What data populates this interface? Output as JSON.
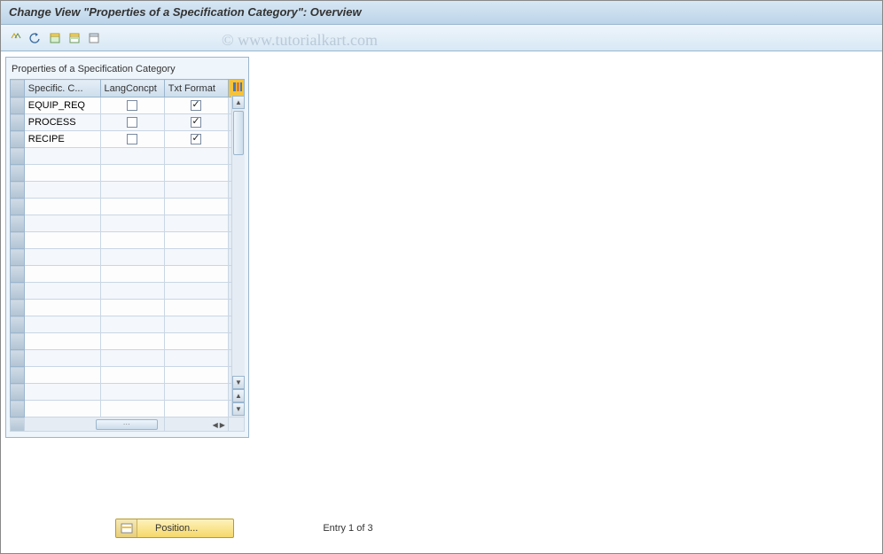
{
  "header": {
    "title": "Change View \"Properties of a Specification Category\": Overview"
  },
  "watermark": "© www.tutorialkart.com",
  "toolbar": {
    "icons": [
      "edit-icon",
      "undo-icon",
      "select-all-icon",
      "select-block-icon",
      "deselect-icon"
    ]
  },
  "panel": {
    "title": "Properties of a Specification Category",
    "columns": [
      "Specific. C...",
      "LangConcpt",
      "Txt Format"
    ],
    "rows": [
      {
        "spec": "EQUIP_REQ",
        "lang": false,
        "txt": true
      },
      {
        "spec": "PROCESS",
        "lang": false,
        "txt": true
      },
      {
        "spec": "RECIPE",
        "lang": false,
        "txt": true
      }
    ],
    "empty_rows": 16
  },
  "footer": {
    "position_label": "Position...",
    "entry_text": "Entry 1 of 3"
  }
}
